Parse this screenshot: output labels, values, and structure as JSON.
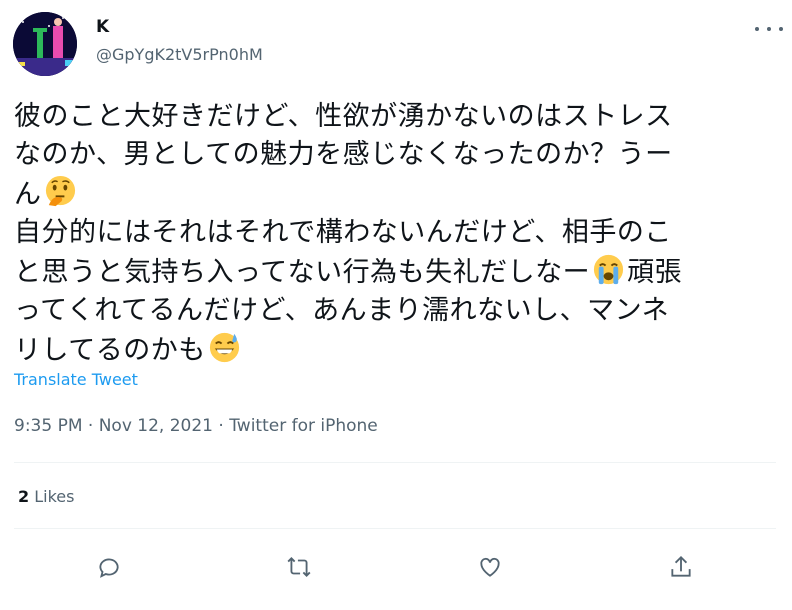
{
  "author": {
    "name": "K",
    "handle": "@GpYgK2tV5rPn0hM"
  },
  "tweet": {
    "line1": "彼のこと大好きだけど、性欲が湧かないのはストレス",
    "line2": "なのか、男としての魅力を感じなくなったのか？うー",
    "line3": "ん",
    "line4": "自分的にはそれはそれで構わないんだけど、相手のこ",
    "line5a": "と思うと気持ち入ってない行為も失礼だしなー",
    "line5b": "頑張",
    "line6": "ってくれてるんだけど、あんまり濡れないし、マンネ",
    "line7": "リしてるのかも",
    "emoji": [
      "thinking-face",
      "loudly-crying-face",
      "grinning-face-with-sweat"
    ]
  },
  "translate_label": "Translate Tweet",
  "timestamp": "9:35 PM · Nov 12, 2021 · ",
  "source": "Twitter for iPhone",
  "likes": {
    "count": "2",
    "label": " Likes"
  },
  "actions": [
    "reply-icon",
    "retweet-icon",
    "like-icon",
    "share-icon"
  ],
  "colors": {
    "link": "#1d9bf0",
    "secondary": "#536471",
    "divider": "#eff3f4"
  }
}
